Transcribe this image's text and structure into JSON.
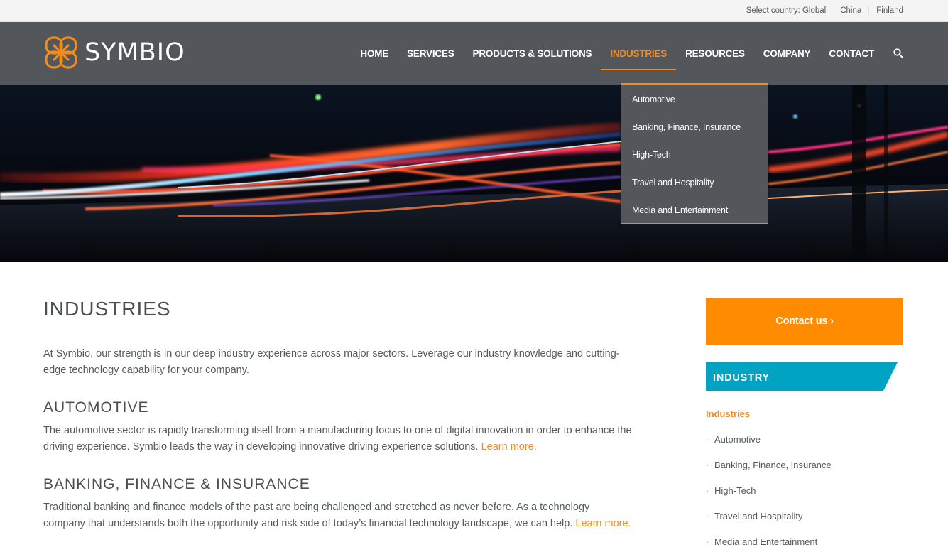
{
  "topbar": {
    "select_label": "Select country: Global",
    "countries": [
      "China",
      "Finland"
    ]
  },
  "brand": {
    "name": "SYMBIO",
    "logo_icon": "interlaced-knot-icon",
    "accent": "#f28c1d"
  },
  "nav": {
    "items": [
      "HOME",
      "SERVICES",
      "PRODUCTS & SOLUTIONS",
      "INDUSTRIES",
      "RESOURCES",
      "COMPANY",
      "CONTACT"
    ],
    "active": "INDUSTRIES",
    "search_icon": "search-icon"
  },
  "dropdown": {
    "items": [
      "Automotive",
      "Banking, Finance, Insurance",
      "High-Tech",
      "Travel and Hospitality",
      "Media and Entertainment"
    ]
  },
  "main": {
    "title": "INDUSTRIES",
    "intro": "At Symbio, our strength is in our deep industry experience across major sectors. Leverage our industry knowledge and cutting-edge technology capability for your company.",
    "sections": [
      {
        "heading": "AUTOMOTIVE",
        "body": "The automotive sector is rapidly transforming itself from a manufacturing focus to one of digital innovation in order to enhance the driving experience. Symbio leads the way in developing innovative driving experience solutions.",
        "link": "Learn more."
      },
      {
        "heading": "BANKING, FINANCE & INSURANCE",
        "body": "Traditional banking and finance models of the past are being challenged and stretched as never before. As a technology company that understands both the opportunity and risk side of today’s financial technology landscape, we can help.",
        "link": "Learn more."
      }
    ]
  },
  "sidebar": {
    "contact_button": "Contact us ›",
    "banner": "INDUSTRY",
    "banner_color": "#00a3c1",
    "button_color": "#ff8c00",
    "list_heading": "Industries",
    "list_items": [
      "Automotive",
      "Banking, Finance, Insurance",
      "High-Tech",
      "Travel and Hospitality",
      "Media and Entertainment"
    ]
  }
}
